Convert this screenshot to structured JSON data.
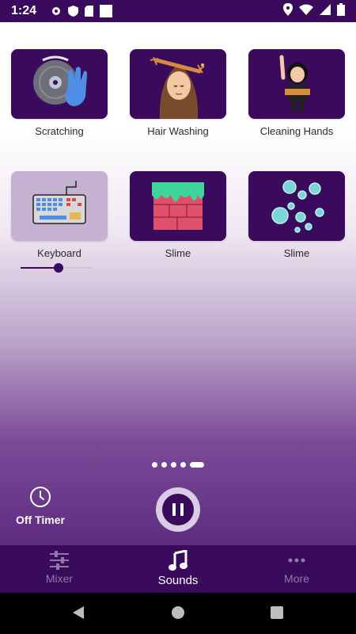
{
  "status_bar": {
    "time": "1:24"
  },
  "tiles": [
    {
      "label": "Scratching",
      "active": true
    },
    {
      "label": "Hair Washing",
      "active": true
    },
    {
      "label": "Cleaning Hands",
      "active": true
    },
    {
      "label": "Keyboard",
      "active": false,
      "volume": 0.55
    },
    {
      "label": "Slime",
      "active": true
    },
    {
      "label": "Slime",
      "active": true
    }
  ],
  "pager": {
    "pages": 5,
    "current": 5
  },
  "timer": {
    "label": "Off Timer",
    "icon": "clock-icon"
  },
  "player": {
    "state": "playing",
    "icon": "pause-icon"
  },
  "bottom_nav": {
    "items": [
      {
        "label": "Mixer",
        "icon": "sliders-icon",
        "active": false
      },
      {
        "label": "Sounds",
        "icon": "music-note-icon",
        "active": true
      },
      {
        "label": "More",
        "icon": "more-dots-icon",
        "active": false
      }
    ]
  },
  "colors": {
    "primary": "#3a0a5c",
    "inactive_tile": "#c4b2d0",
    "nav_inactive": "#8e7aa3"
  }
}
